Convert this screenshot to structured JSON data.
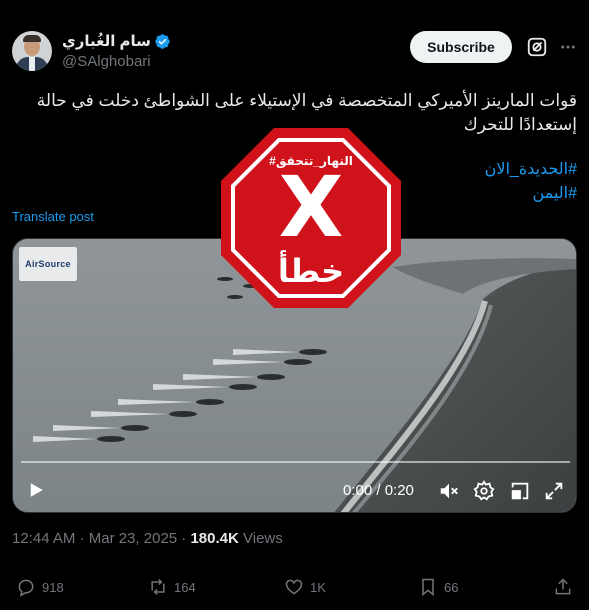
{
  "author": {
    "name": "سام الغُباري",
    "handle": "@SAlghobari"
  },
  "header": {
    "subscribe_label": "Subscribe"
  },
  "tweet": {
    "text": "قوات المارينز الأميركي المتخصصة في الإستيلاء على الشواطئ دخلت في حالة إستعدادًا للتحرك",
    "hashtags": [
      "#الحديدة_الان",
      "#اليمن"
    ],
    "translate_label": "Translate post"
  },
  "video": {
    "source_logo": "AirSource",
    "time_label": "0:00 / 0:20",
    "progress": 0
  },
  "fact_check": {
    "top_label": "#النهار_تتحقق",
    "mark": "X",
    "verdict": "خطأ",
    "color": "#d0121b"
  },
  "meta": {
    "time": "12:44 AM",
    "separator": "·",
    "date": "Mar 23, 2025",
    "views_count": "180.4K",
    "views_label": "Views"
  },
  "actions": {
    "replies": "918",
    "reposts": "164",
    "likes": "1K",
    "bookmarks": "66"
  },
  "colors": {
    "background": "#000000",
    "link": "#1d9bf0",
    "muted": "#71767b",
    "text": "#e7e9ea"
  }
}
